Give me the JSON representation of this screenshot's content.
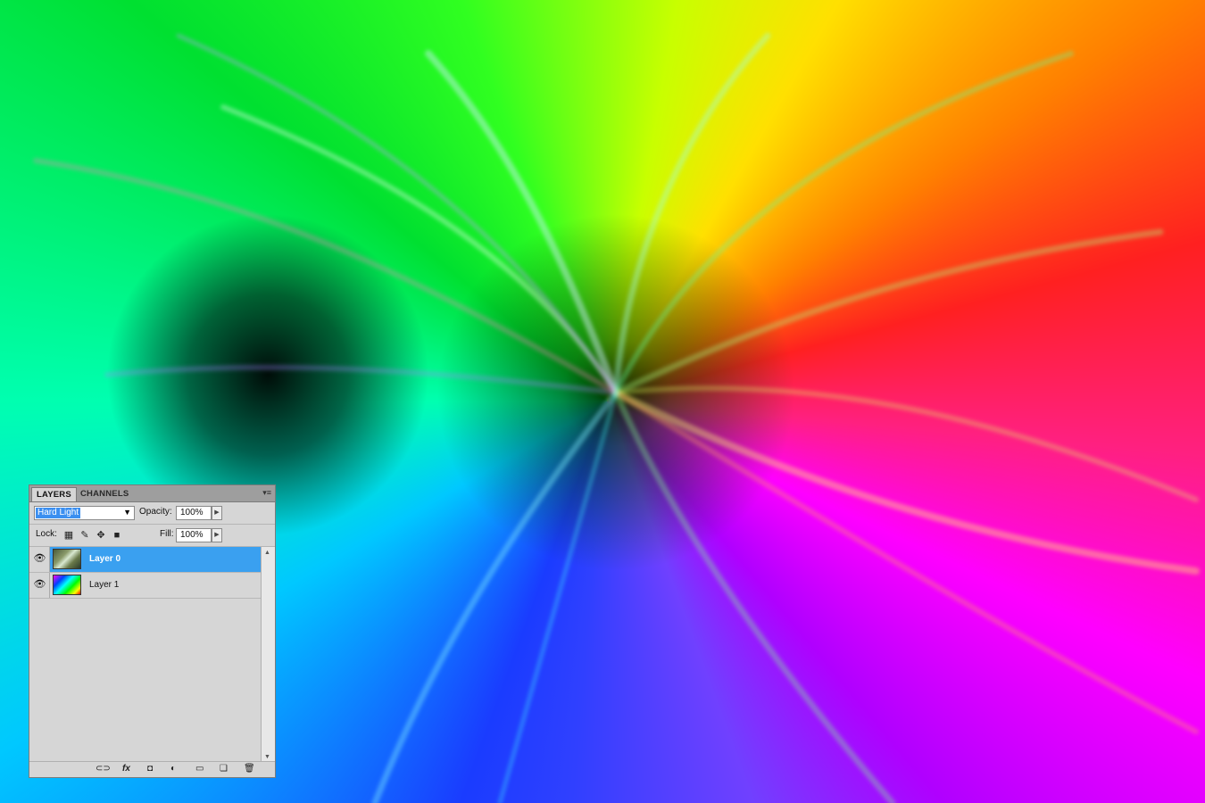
{
  "canvas": {
    "description_icon": "rainbow-swirl-artwork"
  },
  "layers_panel": {
    "tabs": [
      {
        "label": "LAYERS",
        "active": true
      },
      {
        "label": "CHANNELS",
        "active": false
      }
    ],
    "menu_icon": "panel-menu-icon",
    "blend_mode": "Hard Light",
    "opacity_label": "Opacity:",
    "opacity_value": "100%",
    "lock_label": "Lock:",
    "fill_label": "Fill:",
    "fill_value": "100%",
    "layers": [
      {
        "name": "Layer 0",
        "selected": true,
        "visible": true,
        "thumb": "photo"
      },
      {
        "name": "Layer 1",
        "selected": false,
        "visible": true,
        "thumb": "rainbow"
      }
    ],
    "footer_icons": [
      "link-layers-icon",
      "fx-icon",
      "layer-mask-icon",
      "adjustment-layer-icon",
      "new-group-icon",
      "new-layer-icon",
      "trash-icon"
    ]
  },
  "colors": {
    "selection": "#3aa0f0",
    "panel_bg": "#d6d6d6"
  }
}
